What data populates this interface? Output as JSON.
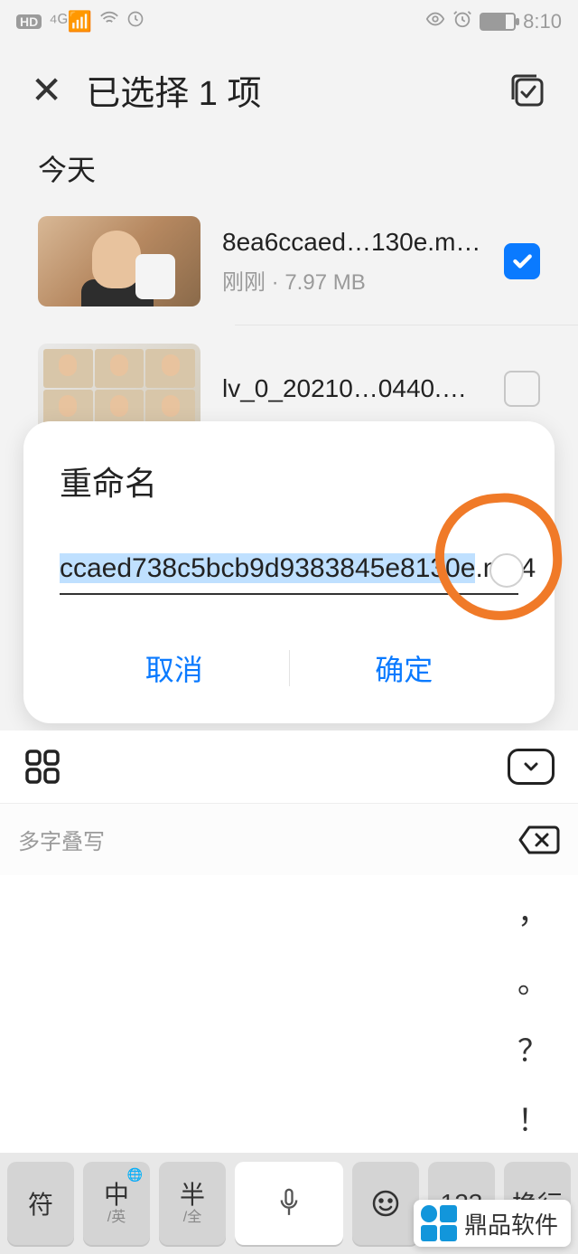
{
  "status": {
    "time": "8:10"
  },
  "header": {
    "title": "已选择 1 项"
  },
  "section": {
    "today": "今天"
  },
  "files": [
    {
      "name": "8ea6ccaed…130e.mp4",
      "meta": "刚刚 · 7.97 MB",
      "checked": true
    },
    {
      "name": "lv_0_20210…0440.mp4",
      "meta": "",
      "checked": false
    }
  ],
  "modal": {
    "title": "重命名",
    "input_selected": "ccaed738c5bcb9d9383845e8130e",
    "input_ext": ".mp4",
    "cancel": "取消",
    "confirm": "确定"
  },
  "ime": {
    "candidate_hint": "多字叠写",
    "puncts": [
      "，",
      "。",
      "？",
      "！"
    ],
    "keys": {
      "sym": "符",
      "zh": "中",
      "zh_sub": "/英",
      "half": "半",
      "half_sub": "/全",
      "num": "123",
      "enter": "换行"
    }
  },
  "watermark": "鼎品软件"
}
